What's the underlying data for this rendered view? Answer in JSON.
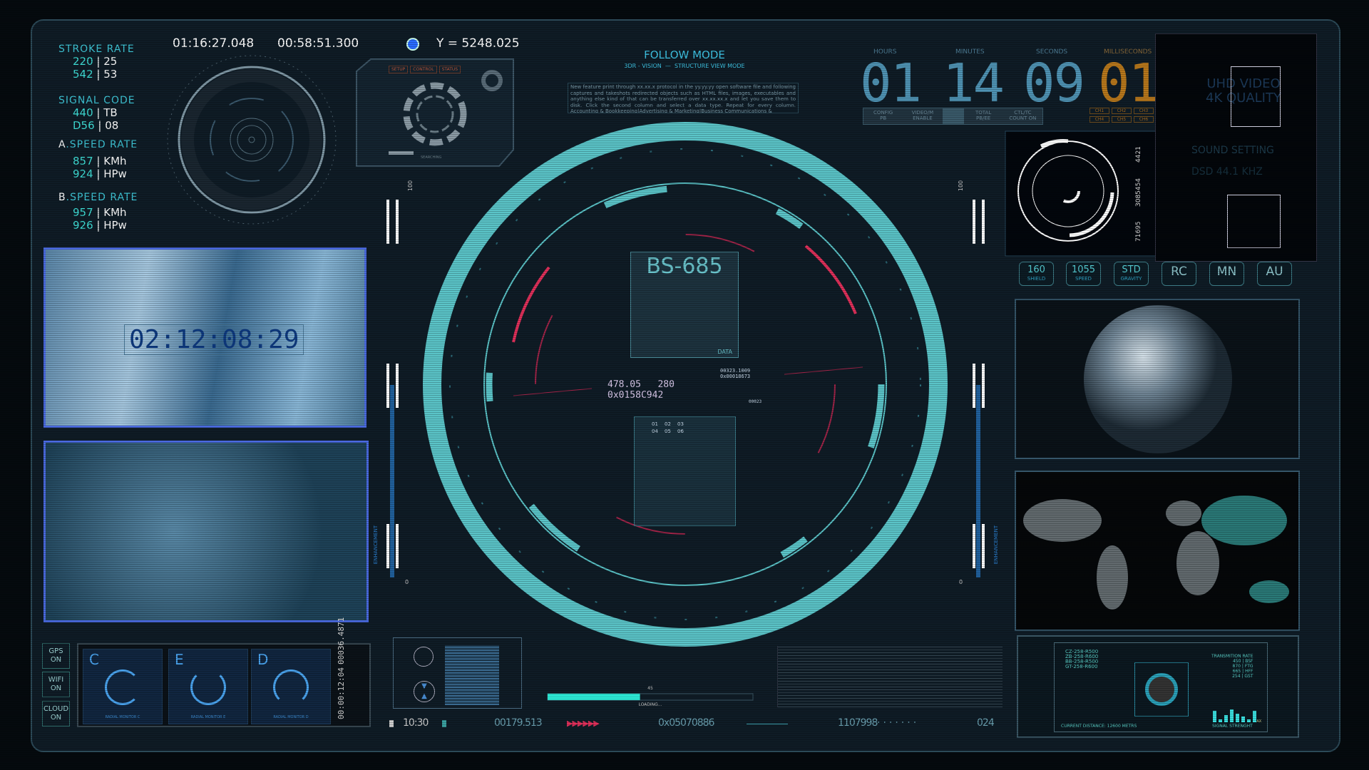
{
  "left_stats": {
    "stroke_rate": {
      "label": "STROKE RATE",
      "rows": [
        [
          "220",
          "25"
        ],
        [
          "542",
          "53"
        ]
      ]
    },
    "signal_code": {
      "label": "SIGNAL CODE",
      "rows": [
        [
          "440",
          "TB"
        ],
        [
          "D56",
          "08"
        ]
      ]
    },
    "a_speed": {
      "prefix": "A",
      "label": "SPEED RATE",
      "rows": [
        [
          "857",
          "KMh"
        ],
        [
          "924",
          "HPw"
        ]
      ]
    },
    "b_speed": {
      "prefix": "B",
      "label": "SPEED RATE",
      "rows": [
        [
          "957",
          "KMh"
        ],
        [
          "926",
          "HPw"
        ]
      ]
    }
  },
  "top": {
    "time1": "01:16:27.048",
    "time2": "00:58:51.300",
    "y_readout": "Y = 5248.025"
  },
  "control_panel": {
    "tabs": [
      "SETUP",
      "CONTROL",
      "STATUS"
    ],
    "status": "SEARCHING"
  },
  "follow": {
    "title": "FOLLOW MODE",
    "sub1": "3DR - VISION",
    "sub2": "STRUCTURE VIEW MODE",
    "paragraph": "New feature print through xx.xx.x protocol in the yy.yy.yy open software file and following captures and takeshots redirected objects such as HTML files, images, executables and anything else kind of that can be transferred over xx.xx.xx.x and let you save them to disk. Click the second column and select a data type. Repeat for every column. Accounting & Bookkeeping|Advertising & Marketing|Business Communications &"
  },
  "clock": {
    "labels": [
      "HOURS",
      "MINUTES",
      "SECONDS",
      "MILLISECONDS"
    ],
    "hours": "01",
    "minutes": "14",
    "seconds": "09",
    "ms": "01",
    "config": [
      [
        "CONFIG",
        "PB"
      ],
      [
        "VIDEO/M",
        "ENABLE"
      ],
      [
        "TOTAL",
        "PB/EE"
      ],
      [
        "CTL/TC",
        "COUNT ON"
      ]
    ],
    "channels": [
      "CH1",
      "CH2",
      "CH3",
      "CH4",
      "CH5",
      "CH6"
    ]
  },
  "video_panel": {
    "title": "UHD VIDEO",
    "sub": "4K QUALITY",
    "sound": "SOUND SETTING",
    "khz": "DSD 44.1 KHZ"
  },
  "radar_small": {
    "values": [
      "71695",
      "3085454",
      "4421"
    ]
  },
  "buttons": [
    {
      "value": "160",
      "label": "SHIELD"
    },
    {
      "value": "1055",
      "label": "SPEED"
    },
    {
      "value": "STD",
      "label": "GRAVITY"
    },
    {
      "value": "RC"
    },
    {
      "value": "MN"
    },
    {
      "value": "AU"
    }
  ],
  "left_map": {
    "timecode": "02:12:08:29"
  },
  "center": {
    "id": "BS-685",
    "card_label": "DATA",
    "readout1": "478.05   280",
    "readout2": "0x0158C942",
    "readout3": "00323.1009",
    "readout4": "0x00018673",
    "readout5": "00023",
    "grid": [
      "01",
      "02",
      "03",
      "04",
      "05",
      "06"
    ],
    "gauge_top": "100",
    "gauge_bottom": "0",
    "gauge_label": "ENHANCEMENT"
  },
  "toggles": [
    {
      "name": "GPS",
      "state": "ON"
    },
    {
      "name": "WIFI",
      "state": "ON"
    },
    {
      "name": "CLOUD",
      "state": "ON"
    }
  ],
  "monitors": [
    {
      "letter": "C",
      "caption": "RADIAL MONITOR C"
    },
    {
      "letter": "E",
      "caption": "RADIAL MONITOR E"
    },
    {
      "letter": "D",
      "caption": "RADIAL MONITOR D"
    }
  ],
  "monitor_readouts": {
    "a": "00:00:12:04",
    "b": "00036.4871"
  },
  "loading": {
    "value": 45,
    "value_label": "45",
    "label": "LOADING..."
  },
  "status_bar": {
    "a": "10:30",
    "b": "00179.513",
    "c": "0x05070886",
    "d": "1107998",
    "e": "024",
    "accent": "#e0305a"
  },
  "target_panel": {
    "codes": [
      "CZ-258-R500",
      "ZB-258-R600",
      "BB-258-R500",
      "GT-258-R600"
    ],
    "trans_title": "TRANSMITION RATE",
    "trans": [
      [
        "450",
        "BSF"
      ],
      [
        "870",
        "FTG"
      ],
      [
        "665",
        "HFF"
      ],
      [
        "254",
        "GST"
      ]
    ],
    "distance": "CURRENT DISTANCE:  12600 METRS",
    "signal": "SIGNAL STRENGHT",
    "max": "MAX",
    "bars": [
      0.8,
      0.2,
      0.5,
      0.9,
      0.6,
      0.4,
      0.2,
      0.8
    ]
  },
  "colors": {
    "accent": "#5bc4c8",
    "alert": "#e0305a",
    "amber": "#c07a1c",
    "bg": "#0f1c26"
  }
}
